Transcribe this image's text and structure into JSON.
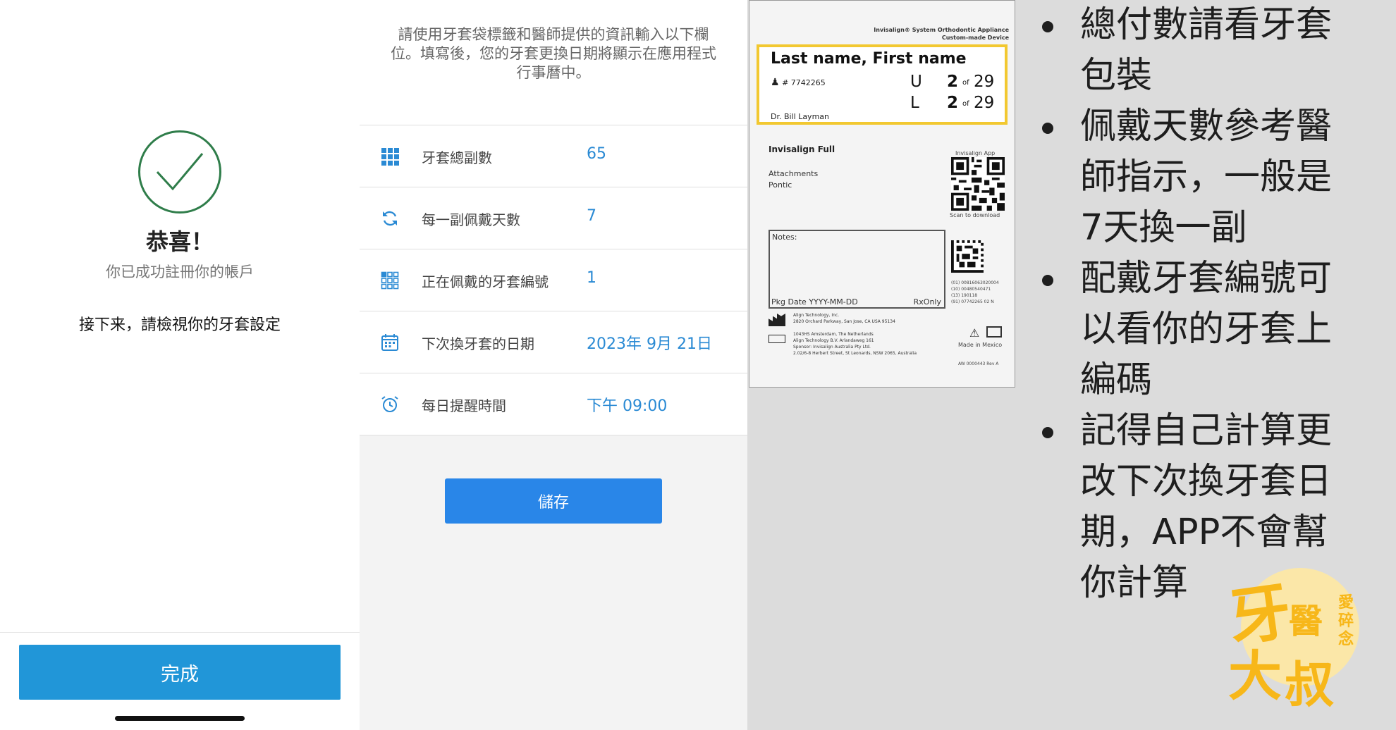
{
  "success_screen": {
    "title": "恭喜！",
    "subtitle": "你已成功註冊你的帳戶",
    "next_step": "接下来，請檢視你的牙套設定",
    "done_button": "完成"
  },
  "settings_screen": {
    "instruction": "請使用牙套袋標籤和醫師提供的資訊輸入以下欄位。填寫後，您的牙套更換日期將顯示在應用程式行事曆中。",
    "rows": [
      {
        "icon": "grid-icon",
        "label": "牙套總副數",
        "value": "65"
      },
      {
        "icon": "refresh-icon",
        "label": "每一副佩戴天數",
        "value": "7"
      },
      {
        "icon": "grid-outline-icon",
        "label": "正在佩戴的牙套編號",
        "value": "1"
      },
      {
        "icon": "calendar-icon",
        "label": "下次換牙套的日期",
        "value": "2023年 9月 21日"
      },
      {
        "icon": "alarm-clock-icon",
        "label": "每日提醒時間",
        "value": "下午 09:00"
      }
    ],
    "save_button": "儲存",
    "accent": "#2a8ad4"
  },
  "package_label": {
    "system_line1": "Invisalign® System Orthodontic Appliance",
    "system_line2": "Custom-made Device",
    "name": "Last name, First name",
    "patient_id": "# 7742265",
    "doctor": "Dr. Bill Layman",
    "upper": {
      "arch": "U",
      "current": "2",
      "of": "of",
      "total": "29"
    },
    "lower": {
      "arch": "L",
      "current": "2",
      "of": "of",
      "total": "29"
    },
    "product": "Invisalign Full",
    "attachments": "Attachments",
    "pontic": "Pontic",
    "app_label": "Invisalign App",
    "scan_label": "Scan to download",
    "notes_label": "Notes:",
    "pkg_date": "Pkg Date YYYY-MM-DD",
    "rx_only": "RxOnly",
    "codes": [
      "(01) 00816063020004",
      "(10) 00480540471",
      "(13) 190118",
      "(91) 07742265 02 N"
    ],
    "address": [
      "Align Technology, Inc.",
      "2820 Orchard Parkway, San Jose, CA USA 95134",
      "",
      "1043HS Amsterdam, The Netherlands",
      "Align Technology B.V. Arlandaweg 161",
      "Sponsor: Invisalign Australia Pty Ltd.",
      "2.02/6-8 Herbert Street, St Leonards, NSW 2065, Australia"
    ],
    "made_in": "Made in Mexico",
    "ref": "AW 0000443 Rev A",
    "highlight_color": "#f2c830"
  },
  "notes": [
    "總付數請看牙套包裝",
    "佩戴天數參考醫師指示，一般是7天換一副",
    "配戴牙套編號可以看你的牙套上編碼",
    "記得自己計算更改下次換牙套日期，APP不會幫你計算"
  ],
  "logo": {
    "chars": [
      "牙",
      "醫",
      "大",
      "叔",
      "愛碎念"
    ],
    "color": "#f7b719"
  }
}
